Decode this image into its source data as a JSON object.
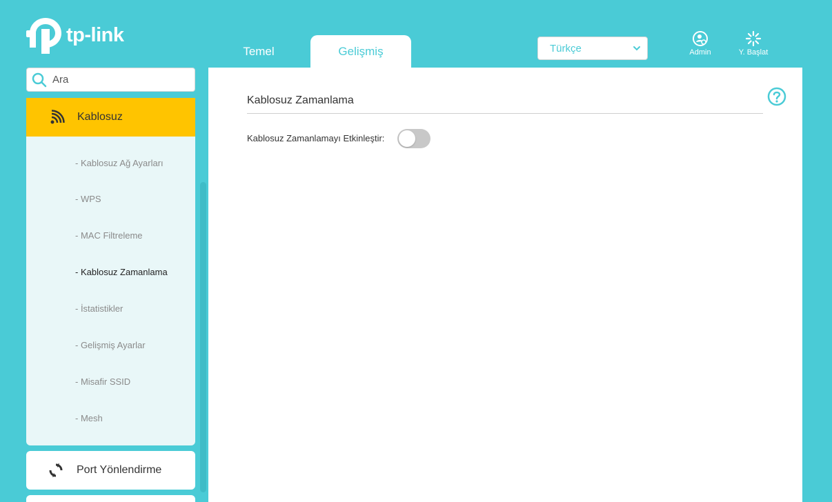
{
  "brand": {
    "logo_text": "tp-link"
  },
  "tabs": [
    {
      "label": "Temel",
      "active": false
    },
    {
      "label": "Gelişmiş",
      "active": true
    }
  ],
  "language": {
    "selected": "Türkçe"
  },
  "header_actions": {
    "admin": "Admin",
    "restart": "Y. Başlat"
  },
  "sidebar": {
    "search_placeholder": "Ara",
    "wireless": {
      "label": "Kablosuz",
      "icon": "wifi-signal-icon",
      "items": [
        {
          "label": "- Kablosuz Ağ Ayarları",
          "active": false
        },
        {
          "label": "- WPS",
          "active": false
        },
        {
          "label": "- MAC Filtreleme",
          "active": false
        },
        {
          "label": "- Kablosuz Zamanlama",
          "active": true
        },
        {
          "label": "- İstatistikler",
          "active": false
        },
        {
          "label": "- Gelişmiş Ayarlar",
          "active": false
        },
        {
          "label": "- Misafir SSID",
          "active": false
        },
        {
          "label": "- Mesh",
          "active": false
        }
      ]
    },
    "port_forwarding": {
      "label": "Port Yönlendirme",
      "icon": "port-forward-icon"
    }
  },
  "main": {
    "section_title": "Kablosuz Zamanlama",
    "enable_label": "Kablosuz Zamanlamayı Etkinleştir:",
    "enable_state": false
  },
  "colors": {
    "background": "#4acbd6",
    "accent": "#4acbd6",
    "active_menu": "#ffc400",
    "submenu_bg": "#e9f7f8"
  }
}
